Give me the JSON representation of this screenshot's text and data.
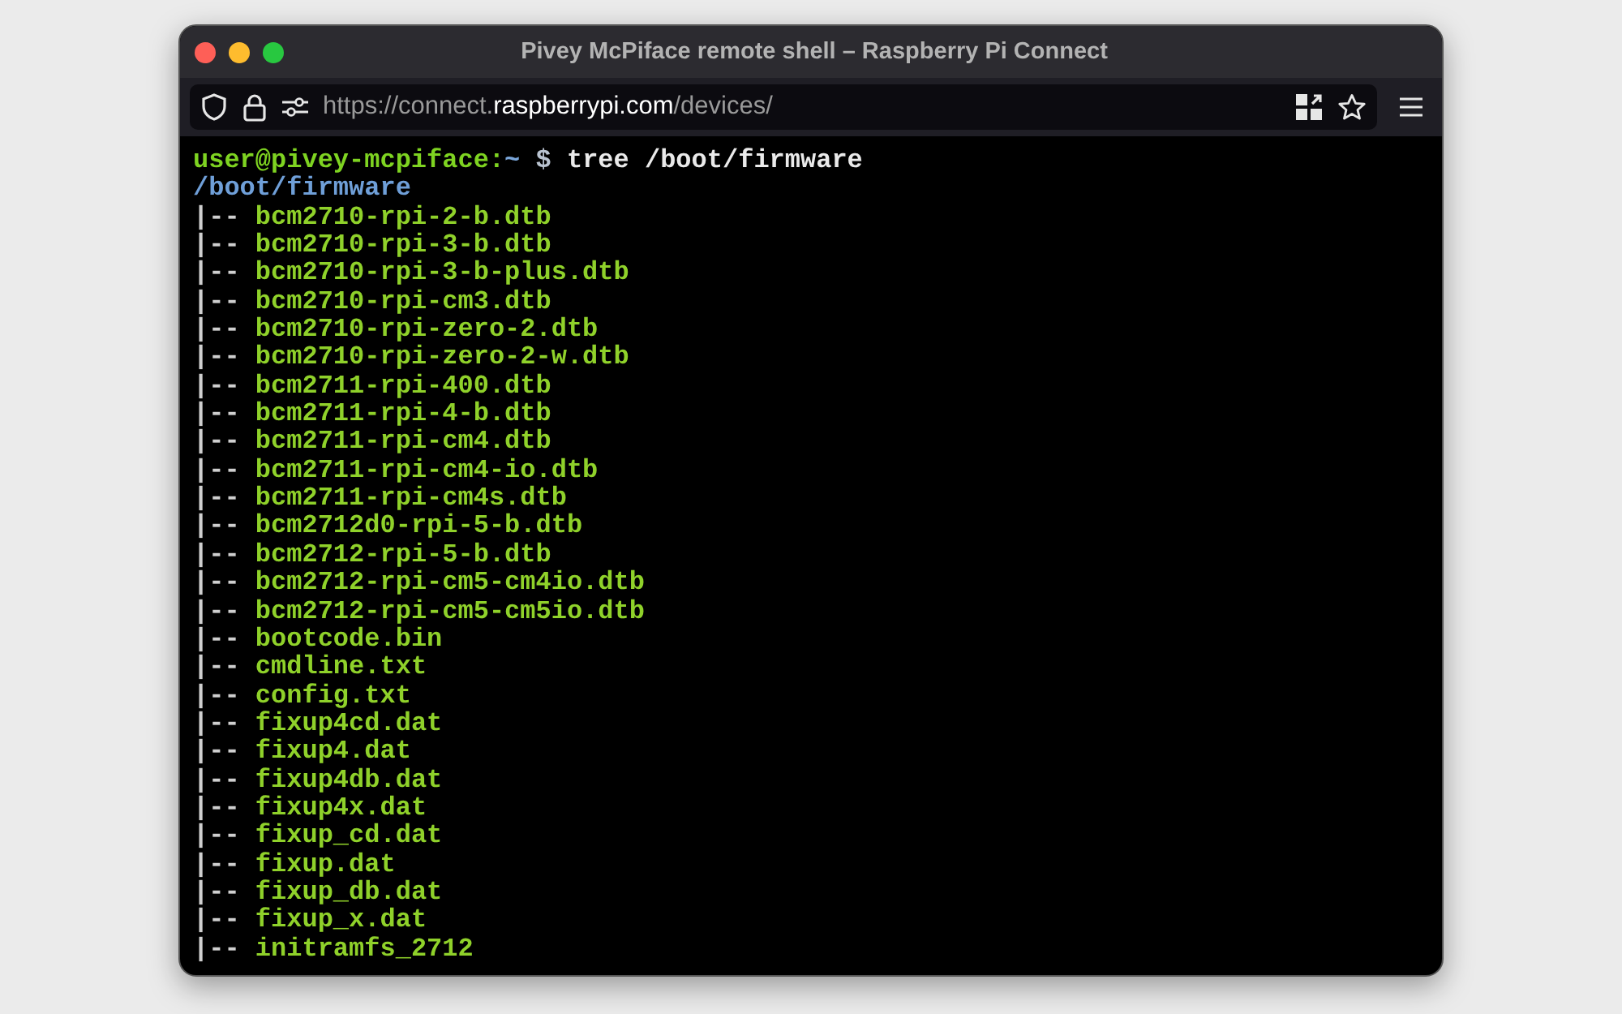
{
  "window": {
    "title": "Pivey McPiface remote shell – Raspberry Pi Connect"
  },
  "address_bar": {
    "url_start": "https://connect.",
    "url_domain": "raspberrypi.com",
    "url_path": "/devices/"
  },
  "terminal": {
    "prompt": {
      "user_host": "user@pivey-mcpiface:",
      "cwd": "~",
      "symbol": "$",
      "command": "tree /boot/firmware"
    },
    "root": "/boot/firmware",
    "entries": [
      {
        "branch": "|--",
        "name": "bcm2710-rpi-2-b.dtb"
      },
      {
        "branch": "|--",
        "name": "bcm2710-rpi-3-b.dtb"
      },
      {
        "branch": "|--",
        "name": "bcm2710-rpi-3-b-plus.dtb"
      },
      {
        "branch": "|--",
        "name": "bcm2710-rpi-cm3.dtb"
      },
      {
        "branch": "|--",
        "name": "bcm2710-rpi-zero-2.dtb"
      },
      {
        "branch": "|--",
        "name": "bcm2710-rpi-zero-2-w.dtb"
      },
      {
        "branch": "|--",
        "name": "bcm2711-rpi-400.dtb"
      },
      {
        "branch": "|--",
        "name": "bcm2711-rpi-4-b.dtb"
      },
      {
        "branch": "|--",
        "name": "bcm2711-rpi-cm4.dtb"
      },
      {
        "branch": "|--",
        "name": "bcm2711-rpi-cm4-io.dtb"
      },
      {
        "branch": "|--",
        "name": "bcm2711-rpi-cm4s.dtb"
      },
      {
        "branch": "|--",
        "name": "bcm2712d0-rpi-5-b.dtb"
      },
      {
        "branch": "|--",
        "name": "bcm2712-rpi-5-b.dtb"
      },
      {
        "branch": "|--",
        "name": "bcm2712-rpi-cm5-cm4io.dtb"
      },
      {
        "branch": "|--",
        "name": "bcm2712-rpi-cm5-cm5io.dtb"
      },
      {
        "branch": "|--",
        "name": "bootcode.bin"
      },
      {
        "branch": "|--",
        "name": "cmdline.txt"
      },
      {
        "branch": "|--",
        "name": "config.txt"
      },
      {
        "branch": "|--",
        "name": "fixup4cd.dat"
      },
      {
        "branch": "|--",
        "name": "fixup4.dat"
      },
      {
        "branch": "|--",
        "name": "fixup4db.dat"
      },
      {
        "branch": "|--",
        "name": "fixup4x.dat"
      },
      {
        "branch": "|--",
        "name": "fixup_cd.dat"
      },
      {
        "branch": "|--",
        "name": "fixup.dat"
      },
      {
        "branch": "|--",
        "name": "fixup_db.dat"
      },
      {
        "branch": "|--",
        "name": "fixup_x.dat"
      },
      {
        "branch": "|--",
        "name": "initramfs_2712"
      }
    ]
  }
}
